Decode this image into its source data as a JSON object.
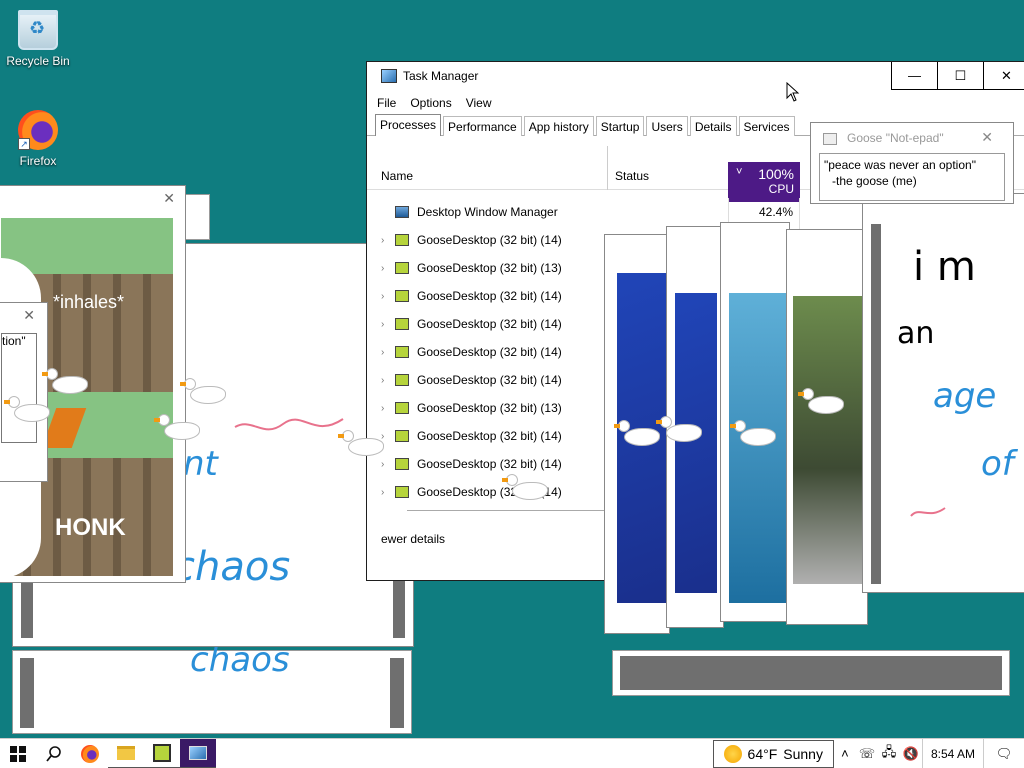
{
  "desktop": {
    "icons": [
      {
        "label": "Recycle Bin",
        "icon": "recycle-bin-icon"
      },
      {
        "label": "Firefox",
        "icon": "firefox-icon"
      }
    ]
  },
  "task_manager": {
    "title": "Task Manager",
    "menu": [
      "File",
      "Options",
      "View"
    ],
    "tabs": [
      "Processes",
      "Performance",
      "App history",
      "Startup",
      "Users",
      "Details",
      "Services"
    ],
    "columns": {
      "name": "Name",
      "status": "Status",
      "cpu_percent": "100%",
      "cpu_label": "CPU"
    },
    "processes": [
      {
        "name": "Desktop Window Manager",
        "cpu": "42.4%"
      },
      {
        "name": "GooseDesktop (32 bit) (14)",
        "cpu": ""
      },
      {
        "name": "GooseDesktop (32 bit) (13)",
        "cpu": ""
      },
      {
        "name": "GooseDesktop (32 bit) (14)",
        "cpu": ""
      },
      {
        "name": "GooseDesktop (32 bit) (14)",
        "cpu": ""
      },
      {
        "name": "GooseDesktop (32 bit) (14)",
        "cpu": ""
      },
      {
        "name": "GooseDesktop (32 bit) (14)",
        "cpu": ""
      },
      {
        "name": "GooseDesktop (32 bit) (13)",
        "cpu": ""
      },
      {
        "name": "GooseDesktop (32 bit) (14)",
        "cpu": ""
      },
      {
        "name": "GooseDesktop (32 bit) (14)",
        "cpu": ""
      },
      {
        "name": "GooseDesktop (32 bit) (14)",
        "cpu": ""
      }
    ],
    "footer": "ewer details",
    "buttons": {
      "minimize": "—",
      "maximize": "☐",
      "close": "✕"
    }
  },
  "note": {
    "title": "Goose \"Not-epad\"",
    "line1": "\"peace was never an option\"",
    "line2": "-the goose (me)"
  },
  "meme_window": {
    "caption_top": "*inhales*",
    "caption_bottom": "HONK",
    "fragment": "tion\""
  },
  "drawing_window": {
    "text_a": "chaos",
    "text_b": "nt",
    "text_c": "chaos"
  },
  "right_note": {
    "line1": "i m",
    "line2": "an",
    "line3": "age",
    "line4": "of"
  },
  "taskbar": {
    "weather_temp": "64°F",
    "weather_text": "Sunny",
    "time": "8:54 AM",
    "pinned": [
      "start-icon",
      "search-icon",
      "firefox-icon",
      "file-explorer-icon",
      "goose-desktop-icon",
      "task-manager-icon"
    ]
  },
  "colors": {
    "desktop": "#0f7d80",
    "cpu_header": "#4d1a86",
    "goose_beak": "#f29a12"
  }
}
